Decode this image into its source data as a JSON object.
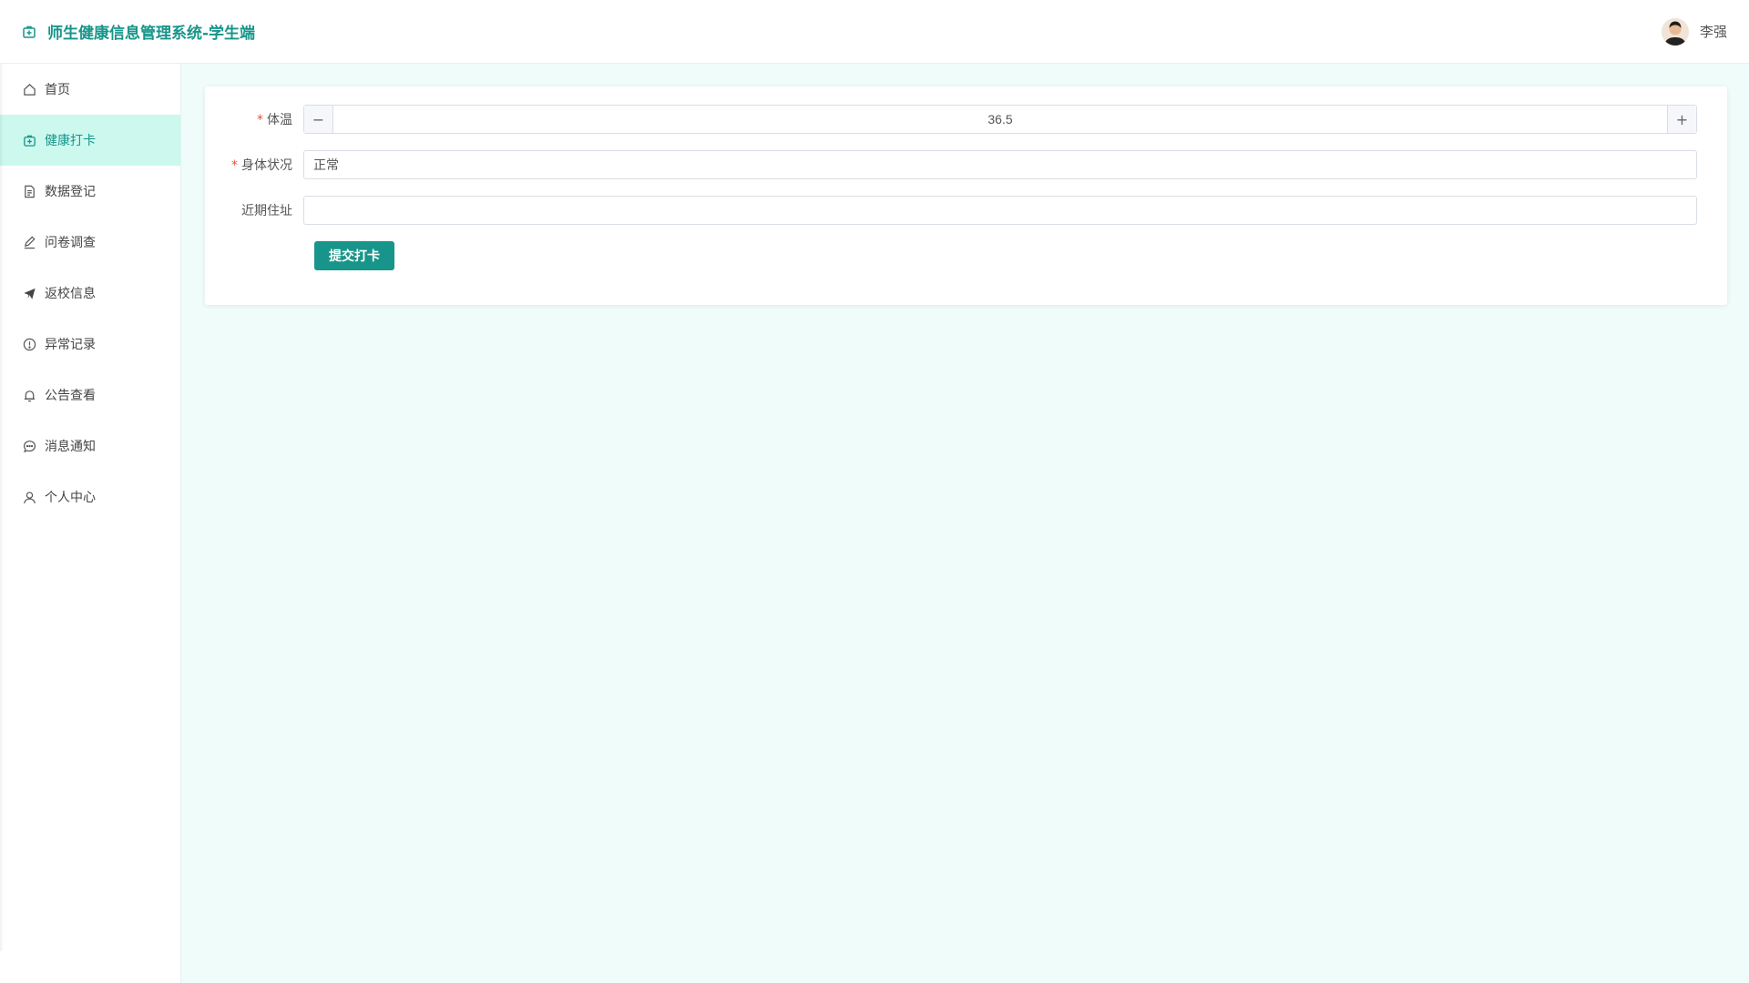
{
  "header": {
    "title": "师生健康信息管理系统-学生端",
    "user_name": "李强"
  },
  "sidebar": {
    "items": [
      {
        "label": "首页",
        "icon": "home-icon"
      },
      {
        "label": "健康打卡",
        "icon": "medical-kit-icon",
        "active": true
      },
      {
        "label": "数据登记",
        "icon": "document-icon"
      },
      {
        "label": "问卷调查",
        "icon": "edit-pen-icon"
      },
      {
        "label": "返校信息",
        "icon": "paper-plane-icon"
      },
      {
        "label": "异常记录",
        "icon": "warning-circle-icon"
      },
      {
        "label": "公告查看",
        "icon": "bell-icon"
      },
      {
        "label": "消息通知",
        "icon": "chat-bubble-icon"
      },
      {
        "label": "个人中心",
        "icon": "user-icon"
      }
    ]
  },
  "form": {
    "temperature": {
      "label": "体温",
      "required": "*",
      "value": "36.5",
      "minus": "−",
      "plus": "+"
    },
    "condition": {
      "label": "身体状况",
      "required": "*",
      "value": "正常"
    },
    "address": {
      "label": "近期住址",
      "value": ""
    },
    "submit_label": "提交打卡"
  },
  "colors": {
    "accent": "#17958a",
    "active_bg": "#ccf8ee",
    "page_bg": "#f0fcfa",
    "required": "#e5533c"
  }
}
